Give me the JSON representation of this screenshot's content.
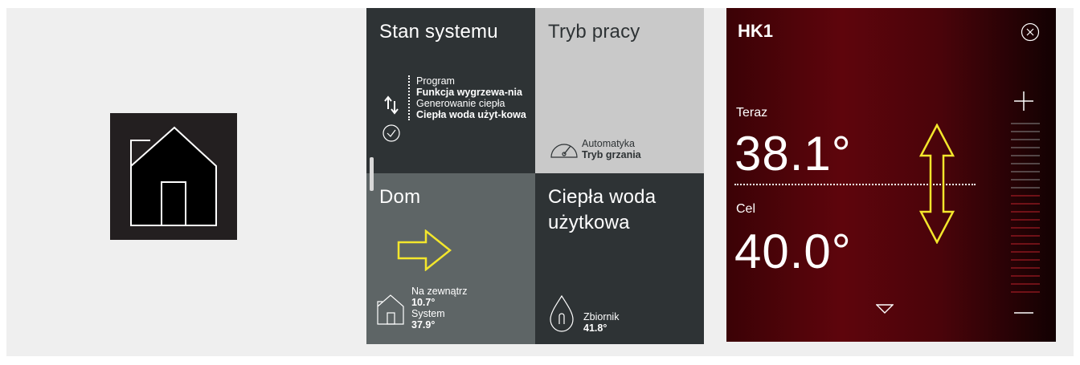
{
  "home_tile": {
    "icon": "house-icon"
  },
  "dashboard": {
    "stan_systemu": {
      "title": "Stan systemu",
      "program_label": "Program",
      "program_value": "Funkcja wygrzewa-nia",
      "gen_label": "Generowanie ciepła",
      "gen_value": "Ciepła woda użyt-kowa",
      "icons": [
        "arrows-updown-icon",
        "check-circle-icon"
      ]
    },
    "tryb_pracy": {
      "title": "Tryb pracy",
      "mode_label": "Automatyka",
      "mode_value": "Tryb grzania",
      "icon": "gauge-icon"
    },
    "dom": {
      "title": "Dom",
      "outside_label": "Na zewnątrz",
      "outside_value": "10.7°",
      "system_label": "System",
      "system_value": "37.9°",
      "icon": "house-icon",
      "annotation_icon": "arrow-right-icon"
    },
    "cwu": {
      "title": "Ciepła woda użytkowa",
      "tank_label": "Zbiornik",
      "tank_value": "41.8°",
      "icon": "water-drop-icon"
    }
  },
  "hk_panel": {
    "title": "HK1",
    "now_label": "Teraz",
    "now_temp": "38.1°",
    "target_label": "Cel",
    "target_temp": "40.0°",
    "close_icon": "close-circle-icon",
    "plus_icon": "plus-icon",
    "minus_icon": "minus-icon",
    "down_icon": "chevron-down-icon",
    "annotation_icon": "arrow-updown-icon"
  },
  "colors": {
    "panel_dark": "#2e3335",
    "panel_light": "#c9c9c9",
    "panel_mid": "#5e6566",
    "hk_red": "#5e050c",
    "annotation_yellow": "#f3e62c"
  }
}
